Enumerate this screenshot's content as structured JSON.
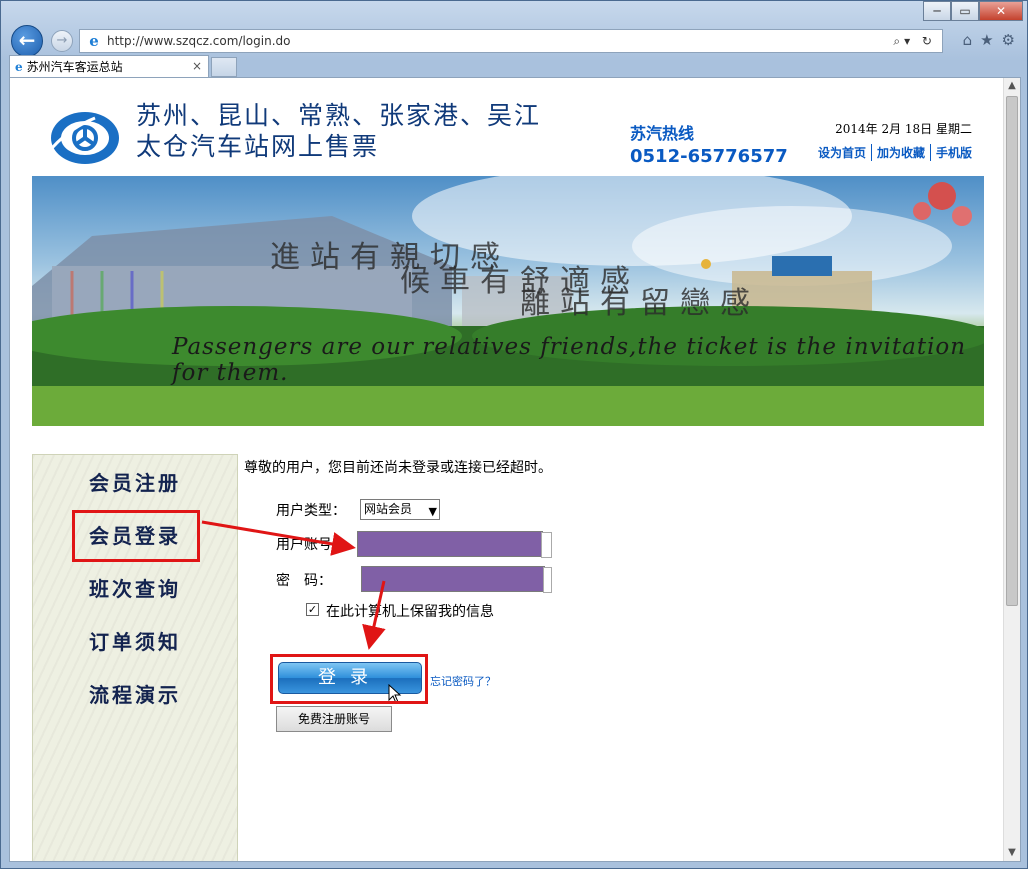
{
  "browser": {
    "url": "http://www.szqcz.com/login.do",
    "tab_title": "苏州汽车客运总站",
    "tab_close": "×",
    "back_glyph": "←",
    "forward_glyph": "→",
    "window_minimize": "─",
    "window_restore": "▭",
    "window_close": "✕",
    "address_tools": "⌕▾ ↻",
    "home_glyph": "⌂",
    "favorites_glyph": "★",
    "settings_glyph": "⚙"
  },
  "header": {
    "title_line1": "苏州、昆山、常熟、张家港、吴江",
    "title_line2": "太仓汽车站网上售票",
    "hotline_label": "苏汽热线",
    "hotline_number": "0512-65776577",
    "date": "2014年 2月 18日 星期二",
    "links": [
      "设为首页",
      "加为收藏",
      "手机版"
    ]
  },
  "banner": {
    "slogan_cn_1": "進站有親切感",
    "slogan_cn_2": "候車有舒適感",
    "slogan_cn_3": "離站有留戀感",
    "slogan_en": "Passengers are our relatives friends,the ticket is the invitation for them."
  },
  "sidebar": {
    "items": [
      {
        "label": "会员注册"
      },
      {
        "label": "会员登录"
      },
      {
        "label": "班次查询"
      },
      {
        "label": "订单须知"
      },
      {
        "label": "流程演示"
      }
    ]
  },
  "form": {
    "notice": "尊敬的用户，您目前还尚未登录或连接已经超时。",
    "user_type_label": "用户类型：",
    "user_type_value": "网站会员",
    "account_label": "用户账号：",
    "password_label": "密　码：",
    "remember_checked": "✓",
    "remember_label": "在此计算机上保留我的信息",
    "login_button": "登录",
    "forgot_link": "忘记密码了？",
    "register_button": "免费注册账号"
  },
  "colors": {
    "highlight": "#e01515",
    "masked_input": "#8060a6",
    "link_blue": "#0a5ac2"
  }
}
